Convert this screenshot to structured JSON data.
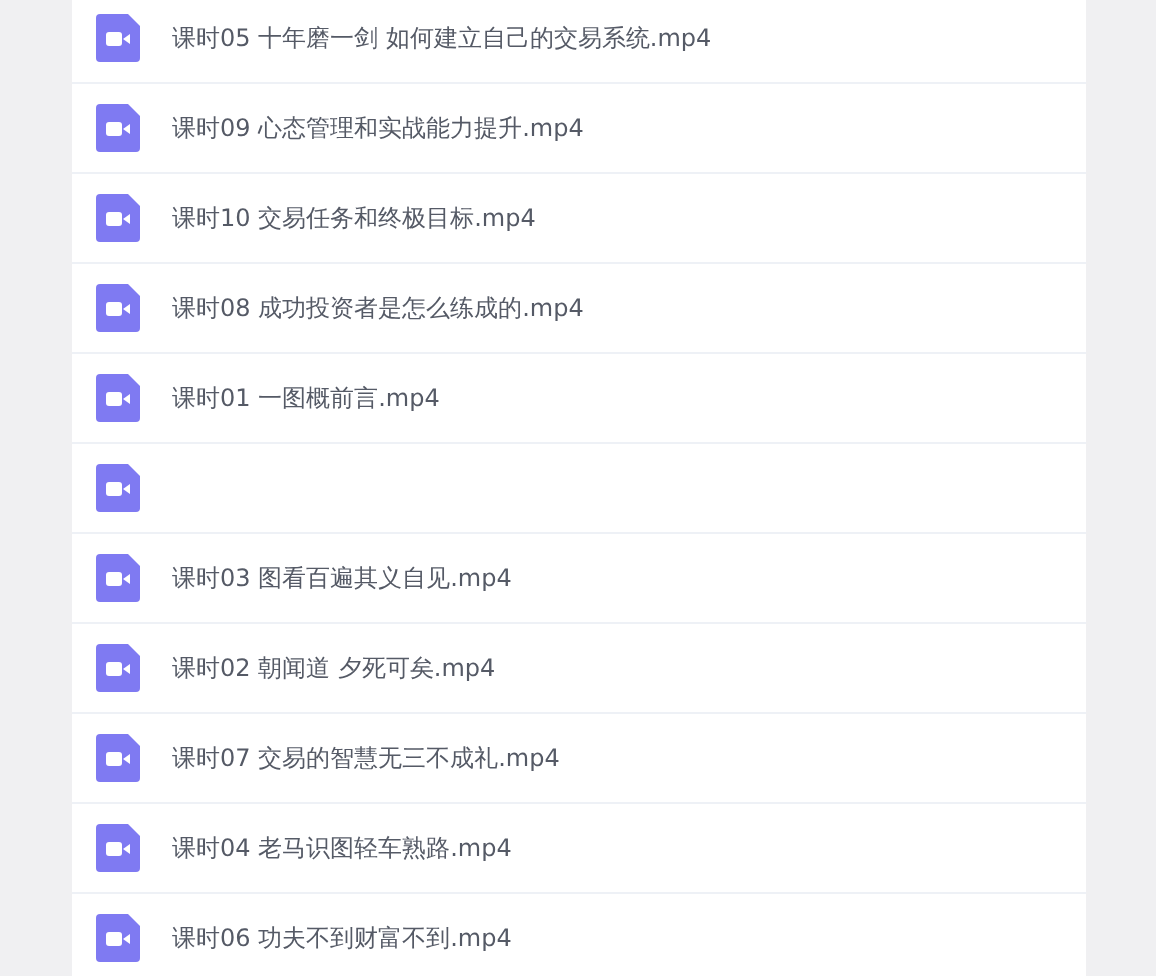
{
  "files": [
    {
      "kind": "video",
      "name": "课时05 十年磨一剑 如何建立自己的交易系统.mp4"
    },
    {
      "kind": "video",
      "name": "课时09 心态管理和实战能力提升.mp4"
    },
    {
      "kind": "video",
      "name": "课时10 交易任务和终极目标.mp4"
    },
    {
      "kind": "video",
      "name": "课时08 成功投资者是怎么练成的.mp4"
    },
    {
      "kind": "video",
      "name": "课时01 一图概前言.mp4"
    },
    {
      "kind": "video"
    },
    {
      "kind": "video",
      "name": "课时03 图看百遍其义自见.mp4"
    },
    {
      "kind": "video",
      "name": "课时02 朝闻道 夕死可矣.mp4"
    },
    {
      "kind": "video",
      "name": "课时07 交易的智慧无三不成礼.mp4"
    },
    {
      "kind": "video",
      "name": "课时04 老马识图轻车熟路.mp4"
    },
    {
      "kind": "video",
      "name": "课时06 功夫不到财富不到.mp4"
    }
  ]
}
